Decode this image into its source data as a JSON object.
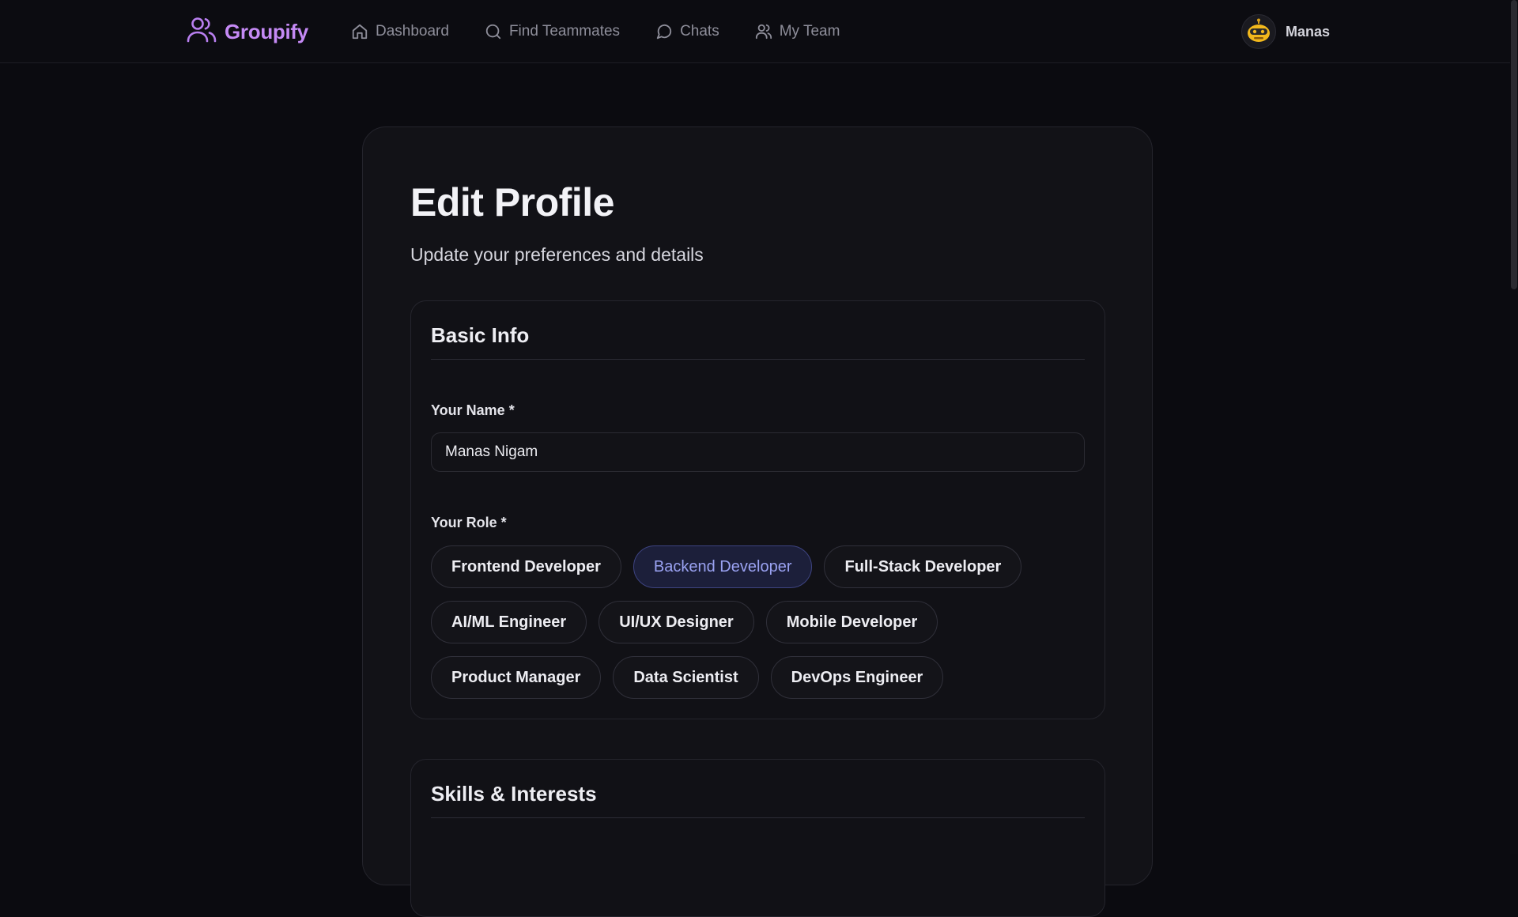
{
  "brand": {
    "name": "Groupify",
    "accent": "#c58af5"
  },
  "nav": [
    {
      "label": "Dashboard",
      "icon": "home-icon"
    },
    {
      "label": "Find Teammates",
      "icon": "search-icon"
    },
    {
      "label": "Chats",
      "icon": "chat-bubble-icon"
    },
    {
      "label": "My Team",
      "icon": "users-icon"
    }
  ],
  "user": {
    "name": "Manas",
    "avatar_icon": "robot-avatar-icon"
  },
  "page": {
    "title": "Edit Profile",
    "subtitle": "Update your preferences and details"
  },
  "basic_info": {
    "title": "Basic Info",
    "name_label": "Your Name *",
    "name_value": "Manas Nigam",
    "role_label": "Your Role *",
    "roles": [
      [
        "Frontend Developer",
        "Backend Developer",
        "Full-Stack Developer"
      ],
      [
        "AI/ML Engineer",
        "UI/UX Designer",
        "Mobile Developer"
      ],
      [
        "Product Manager",
        "Data Scientist",
        "DevOps Engineer"
      ]
    ],
    "selected_role": "Backend Developer",
    "selected_color": "#9aa2f2"
  },
  "skills": {
    "title": "Skills & Interests"
  }
}
